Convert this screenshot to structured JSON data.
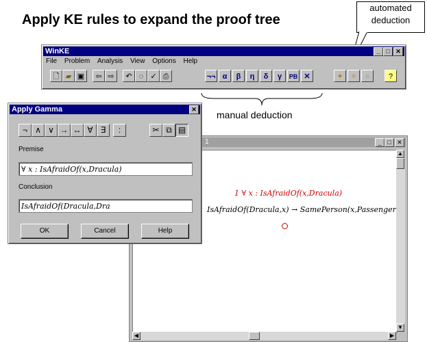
{
  "heading": "Apply KE rules to expand the proof tree",
  "callout": {
    "line1": "automated",
    "line2": "deduction"
  },
  "manual_label": "manual deduction",
  "winke": {
    "title": "WinKE",
    "menu": [
      "File",
      "Problem",
      "Analysis",
      "View",
      "Options",
      "Help"
    ],
    "toolbar": {
      "rule_buttons": [
        "¬¬",
        "α",
        "β",
        "η",
        "δ",
        "γ",
        "PB",
        "✕"
      ],
      "help_glyph": "?"
    }
  },
  "document": {
    "title_fragment": "1",
    "node1": "1 ∀ x : IsAfraidOf(x,Dracula)",
    "node2": "IsAfraidOf(Dracula,x) → SamePerson(x,Passenger)"
  },
  "dialog": {
    "title": "Apply Gamma",
    "symbols": [
      "¬",
      "∧",
      "∨",
      "→",
      "↔",
      "∀",
      "∃",
      ":"
    ],
    "premise_label": "Premise",
    "premise_value": "∀ x : IsAfraidOf(x,Dracula)",
    "conclusion_label": "Conclusion",
    "conclusion_value": "IsAfraidOf(Dracula,Dra",
    "ok_label": "OK",
    "cancel_label": "Cancel",
    "help_label": "Help",
    "close_glyph": "✕"
  }
}
